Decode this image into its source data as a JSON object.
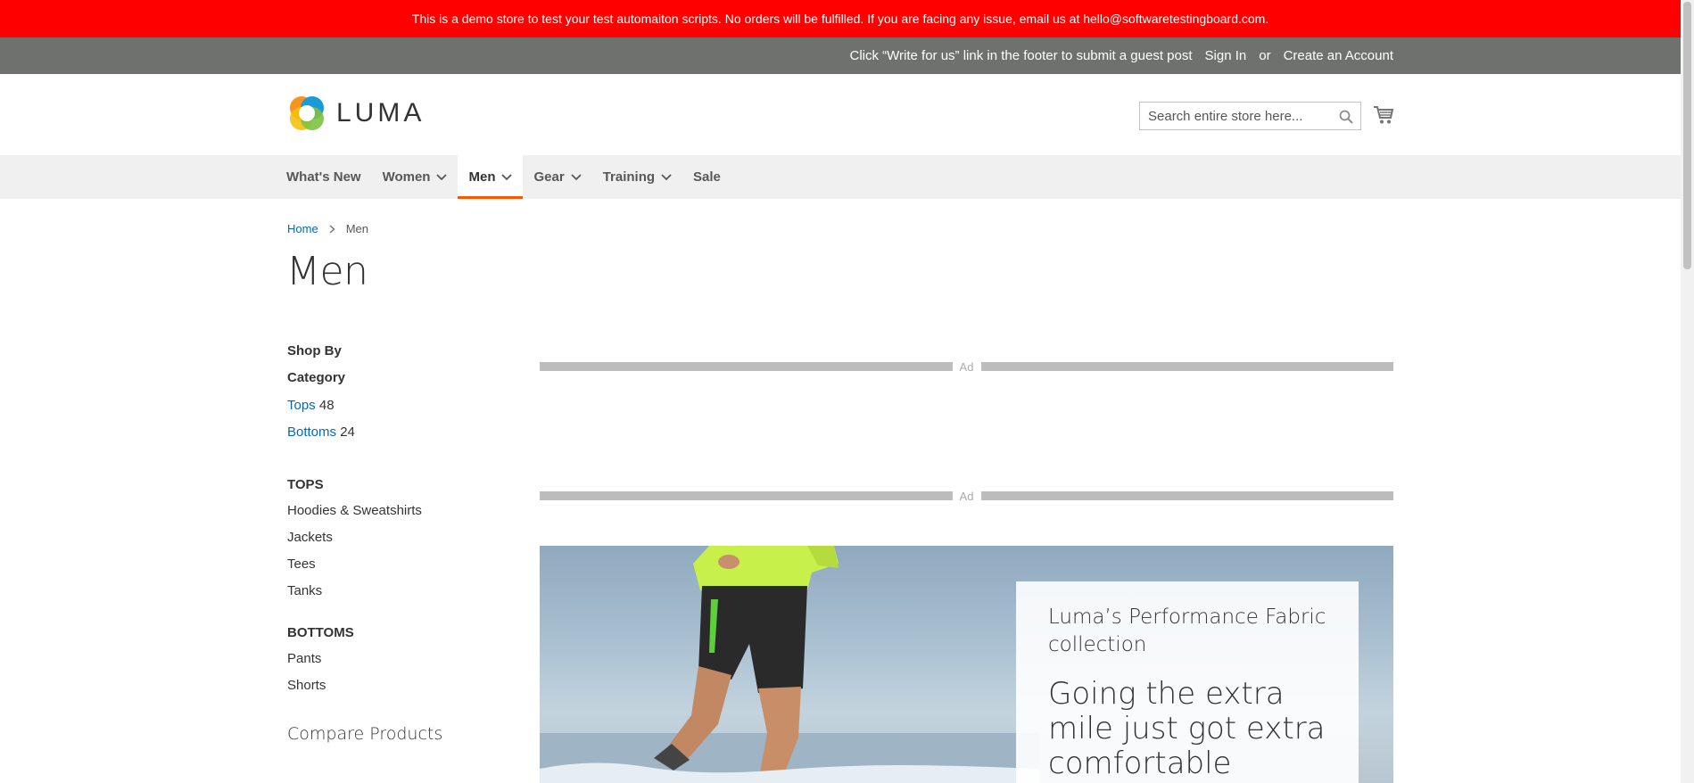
{
  "demo_banner": "This is a demo store to test your test automaiton scripts. No orders will be fulfilled. If you are facing any issue, email us at hello@softwaretestingboard.com.",
  "panel": {
    "guest_post": "Click “Write for us” link in the footer to submit a guest post",
    "sign_in": "Sign In",
    "or": "or",
    "create_account": "Create an Account"
  },
  "header": {
    "logo_text": "LUMA",
    "search_placeholder": "Search entire store here...",
    "icons": {
      "search": "search-icon",
      "cart": "cart-icon"
    }
  },
  "nav": {
    "items": [
      {
        "label": "What's New",
        "dropdown": false,
        "active": false
      },
      {
        "label": "Women",
        "dropdown": true,
        "active": false
      },
      {
        "label": "Men",
        "dropdown": true,
        "active": true
      },
      {
        "label": "Gear",
        "dropdown": true,
        "active": false
      },
      {
        "label": "Training",
        "dropdown": true,
        "active": false
      },
      {
        "label": "Sale",
        "dropdown": false,
        "active": false
      }
    ]
  },
  "breadcrumb": {
    "home": "Home",
    "current": "Men"
  },
  "page_title": "Men",
  "sidebar": {
    "shop_by": "Shop By",
    "category_title": "Category",
    "categories": [
      {
        "label": "Tops",
        "count": "48"
      },
      {
        "label": "Bottoms",
        "count": "24"
      }
    ],
    "tops_title": "TOPS",
    "tops": [
      "Hoodies & Sweatshirts",
      "Jackets",
      "Tees",
      "Tanks"
    ],
    "bottoms_title": "BOTTOMS",
    "bottoms": [
      "Pants",
      "Shorts"
    ],
    "compare_title": "Compare Products"
  },
  "ads": {
    "label": "Ad"
  },
  "hero": {
    "subtitle": "Luma’s Performance Fabric collection",
    "headline": "Going the extra mile just got extra comfortable"
  },
  "colors": {
    "banner": "#ff0000",
    "panel": "#6e716e",
    "nav_bg": "#f0f0f0",
    "nav_active_underline": "#ff5501",
    "link": "#006bb4"
  }
}
